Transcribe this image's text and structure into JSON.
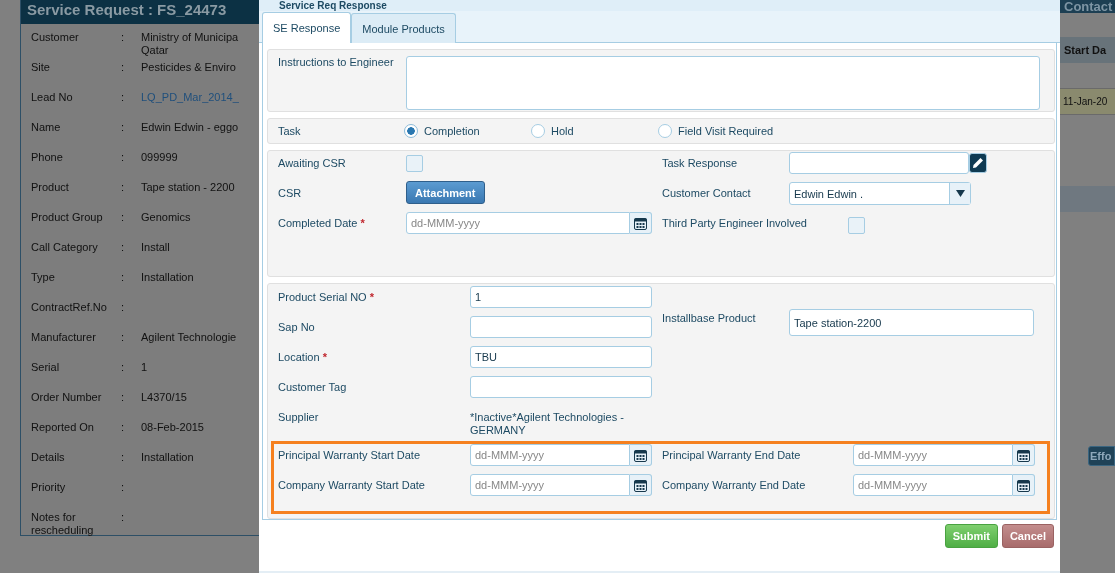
{
  "background": {
    "panel_title": "Service Request : FS_24473",
    "details": [
      {
        "label": "Customer",
        "value": "Ministry of Municipa",
        "value_2": "Qatar",
        "kind": "text"
      },
      {
        "label": "Site",
        "value": "Pesticides & Enviro",
        "kind": "text"
      },
      {
        "label": "Lead No",
        "value": "LQ_PD_Mar_2014_",
        "kind": "link"
      },
      {
        "label": "Name",
        "value": "Edwin Edwin - eggo",
        "kind": "text"
      },
      {
        "label": "Phone",
        "value": "099999",
        "kind": "text"
      },
      {
        "label": "Product",
        "value": "Tape station - 2200",
        "kind": "text"
      },
      {
        "label": "Product Group",
        "value": "Genomics",
        "kind": "text"
      },
      {
        "label": "Call Category",
        "value": "Install",
        "kind": "text"
      },
      {
        "label": "Type",
        "value": "Installation",
        "kind": "text"
      },
      {
        "label": "ContractRef.No"
      },
      {
        "label": "Manufacturer",
        "value": "Agilent Technologie",
        "kind": "text"
      },
      {
        "label": "Serial",
        "value": "1",
        "kind": "text"
      },
      {
        "label": "Order Number",
        "value": "L4370/15",
        "kind": "text"
      },
      {
        "label": "Reported On",
        "value": "08-Feb-2015",
        "kind": "text"
      },
      {
        "label": "Details",
        "value": "Installation",
        "kind": "text"
      },
      {
        "label": "Priority"
      },
      {
        "label": "Notes for rescheduling"
      }
    ],
    "separator": ":",
    "side": {
      "contact_button": "Contact",
      "column_header": "Start Da",
      "date_cell": "11-Jan-20",
      "effort_button": "Effo"
    }
  },
  "dialog": {
    "title": "Service Req Response",
    "tabs": [
      {
        "label": "SE Response",
        "selected": true
      },
      {
        "label": "Module Products",
        "selected": false
      }
    ],
    "instructions": {
      "label": "Instructions to Engineer"
    },
    "task": {
      "label": "Task",
      "options": [
        {
          "label": "Completion",
          "selected": true
        },
        {
          "label": "Hold",
          "selected": false
        },
        {
          "label": "Field Visit Required",
          "selected": false
        }
      ]
    },
    "status_left": [
      {
        "kind": "checkbox",
        "label": "Awaiting CSR",
        "checked": false
      },
      {
        "kind": "button",
        "label": "CSR",
        "button": "Attachment"
      },
      {
        "kind": "date",
        "label": "Completed Date",
        "mark": "*",
        "placeholder": "dd-MMM-yyyy"
      }
    ],
    "status_right": [
      {
        "kind": "edit",
        "label": "Task Response"
      },
      {
        "kind": "select",
        "label": "Customer Contact",
        "value": "Edwin Edwin ."
      },
      {
        "kind": "checkbox",
        "label": "Third Party Engineer Involved",
        "checked": false
      }
    ],
    "product_left": [
      {
        "kind": "input",
        "label": "Product Serial NO",
        "mark": "*",
        "value": "1"
      },
      {
        "kind": "input",
        "label": "Sap No"
      },
      {
        "kind": "input",
        "label": "Location",
        "mark": "*",
        "value": "TBU"
      },
      {
        "kind": "input",
        "label": "Customer Tag"
      },
      {
        "kind": "static",
        "label": "Supplier",
        "value": "*Inactive*Agilent Technologies - GERMANY"
      }
    ],
    "product_right": [
      {
        "kind": "input",
        "label": "Installbase Product",
        "value": "Tape station-2200"
      }
    ],
    "warranty": {
      "highlighted": true,
      "fields": [
        {
          "label": "Principal Warranty Start Date",
          "placeholder": "dd-MMM-yyyy"
        },
        {
          "label": "Principal Warranty End Date",
          "placeholder": "dd-MMM-yyyy"
        },
        {
          "label": "Company Warranty Start Date",
          "placeholder": "dd-MMM-yyyy"
        },
        {
          "label": "Company Warranty End Date",
          "placeholder": "dd-MMM-yyyy"
        }
      ]
    },
    "buttons": [
      {
        "label": "Submit",
        "kind": "primary"
      },
      {
        "label": "Cancel",
        "kind": "danger"
      }
    ]
  }
}
